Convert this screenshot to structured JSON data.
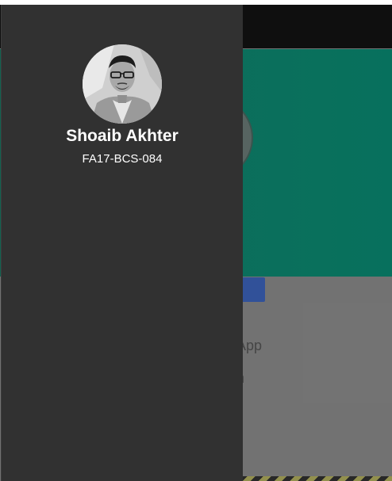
{
  "drawer": {
    "user_name": "Shoaib Akhter",
    "user_id": "FA17-BCS-084",
    "avatar_icon": "user-photo"
  },
  "background": {
    "line1": "my App",
    "line2": "ullah",
    "hero_color": "#0d7561",
    "button_color": "#3557a3"
  }
}
